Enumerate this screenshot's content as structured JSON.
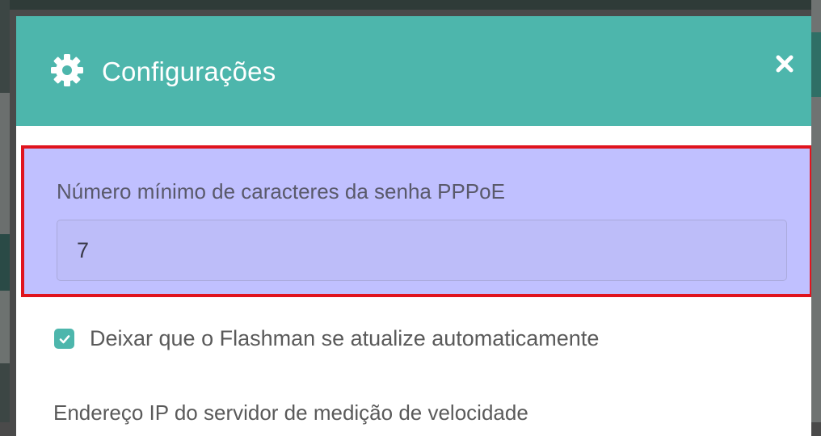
{
  "modal": {
    "title": "Configurações",
    "icon": "gear-icon",
    "close_icon": "close-icon"
  },
  "pppoe_field": {
    "label": "Número mínimo de caracteres da senha PPPoE",
    "value": "7"
  },
  "auto_update": {
    "label": "Deixar que o Flashman se atualize automaticamente",
    "checked": true
  },
  "speedtest_field": {
    "label": "Endereço IP do servidor de medição de velocidade"
  },
  "colors": {
    "header": "#4db6ac",
    "highlight_bg": "#c0c0ff",
    "highlight_border": "#e0141e"
  }
}
